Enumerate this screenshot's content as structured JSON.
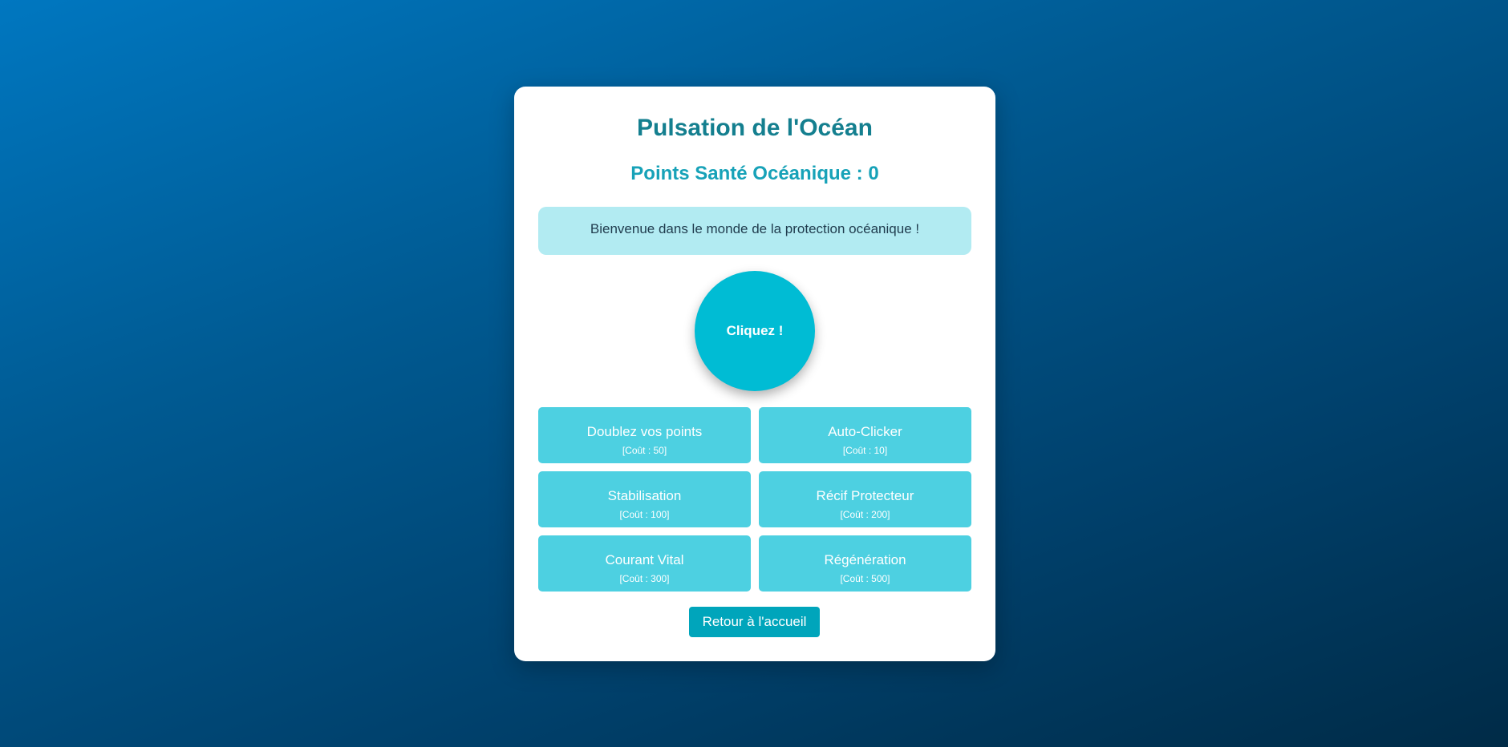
{
  "game": {
    "title": "Pulsation de l'Océan",
    "score_text": "Points Santé Océanique : 0",
    "message": "Bienvenue dans le monde de la protection océanique !",
    "click_label": "Cliquez !",
    "back_label": "Retour à l'accueil"
  },
  "upgrades": [
    {
      "name": "Doublez vos points",
      "cost": "[Coût : 50]"
    },
    {
      "name": "Auto-Clicker",
      "cost": "[Coût : 10]"
    },
    {
      "name": "Stabilisation",
      "cost": "[Coût : 100]"
    },
    {
      "name": "Récif Protecteur",
      "cost": "[Coût : 200]"
    },
    {
      "name": "Courant Vital",
      "cost": "[Coût : 300]"
    },
    {
      "name": "Régénération",
      "cost": "[Coût : 500]"
    }
  ],
  "colors": {
    "title": "#147f8f",
    "score": "#17a2b8",
    "message_bg": "#b2ebf2",
    "click_button": "#00bcd4",
    "upgrade_button": "#4dd0e1",
    "back_button": "#00a5bb"
  }
}
